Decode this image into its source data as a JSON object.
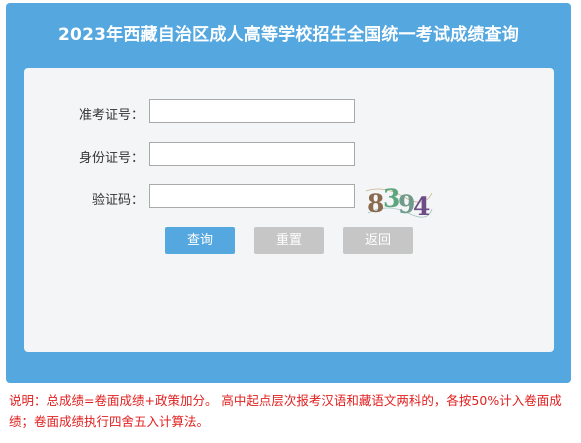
{
  "header": {
    "title": "2023年西藏自治区成人高等学校招生全国统一考试成绩查询"
  },
  "form": {
    "exam_number_label": "准考证号：",
    "exam_number_value": "",
    "id_number_label": "身份证号：",
    "id_number_value": "",
    "captcha_label": "验证码：",
    "captcha_value": "",
    "captcha_text": "8394"
  },
  "buttons": {
    "query": "查询",
    "reset": "重置",
    "back": "返回"
  },
  "notice": {
    "text": "说明：总成绩=卷面成绩+政策加分。 高中起点层次报考汉语和藏语文两科的，各按50%计入卷面成绩；卷面成绩执行四舍五入计算法。"
  },
  "colors": {
    "panel": "#55a7e0",
    "card": "#f4f5f6",
    "primary_button": "#55a7e0",
    "secondary_button": "#c6c6c6",
    "notice_text": "#e02020"
  }
}
